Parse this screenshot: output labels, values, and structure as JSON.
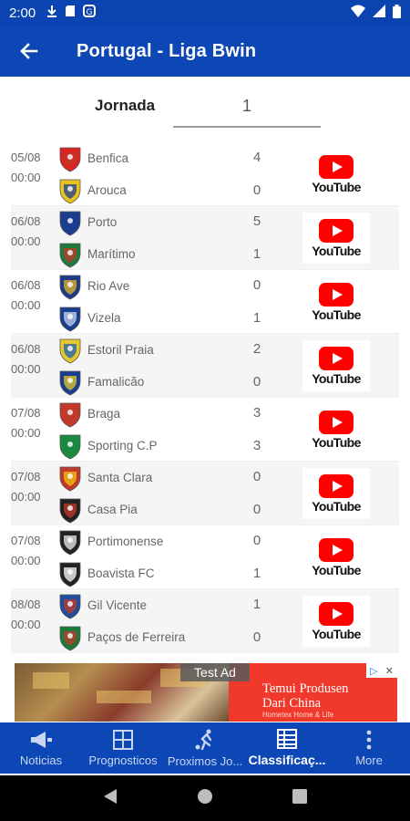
{
  "status_bar": {
    "time": "2:00"
  },
  "app_bar": {
    "title": "Portugal - Liga Bwin"
  },
  "jornada": {
    "label": "Jornada",
    "value": "1"
  },
  "matches": [
    {
      "date": "05/08",
      "time": "00:00",
      "home": "Benfica",
      "away": "Arouca",
      "home_score": "4",
      "away_score": "0"
    },
    {
      "date": "06/08",
      "time": "00:00",
      "home": "Porto",
      "away": "Marítimo",
      "home_score": "5",
      "away_score": "1"
    },
    {
      "date": "06/08",
      "time": "00:00",
      "home": "Rio Ave",
      "away": "Vizela",
      "home_score": "0",
      "away_score": "1"
    },
    {
      "date": "06/08",
      "time": "00:00",
      "home": "Estoril Praia",
      "away": "Famalicão",
      "home_score": "2",
      "away_score": "0"
    },
    {
      "date": "07/08",
      "time": "00:00",
      "home": "Braga",
      "away": "Sporting C.P",
      "home_score": "3",
      "away_score": "3"
    },
    {
      "date": "07/08",
      "time": "00:00",
      "home": "Santa Clara",
      "away": "Casa Pia",
      "home_score": "0",
      "away_score": "0"
    },
    {
      "date": "07/08",
      "time": "00:00",
      "home": "Portimonense",
      "away": "Boavista FC",
      "home_score": "0",
      "away_score": "1"
    },
    {
      "date": "08/08",
      "time": "00:00",
      "home": "Gil Vicente",
      "away": "Paços de Ferreira",
      "home_score": "1",
      "away_score": "0"
    }
  ],
  "youtube_label": "YouTube",
  "ad": {
    "badge": "Test Ad",
    "text_line1": "Temui Produsen",
    "text_line2": "Dari China",
    "sub": "Hometex Home & Life"
  },
  "bottom_nav": [
    {
      "label": "Noticias",
      "icon": "megaphone-icon"
    },
    {
      "label": "Prognosticos",
      "icon": "grid-icon"
    },
    {
      "label": "Proximos Jo...",
      "icon": "soccer-player-icon"
    },
    {
      "label": "Classificaç...",
      "icon": "table-icon",
      "active": true
    },
    {
      "label": "More",
      "icon": "more-vert-icon"
    }
  ],
  "colors": {
    "primary": "#0d47b5",
    "status_bar": "#0b44b1",
    "youtube_red": "#ff0000",
    "row_alt": "#f5f5f5"
  }
}
